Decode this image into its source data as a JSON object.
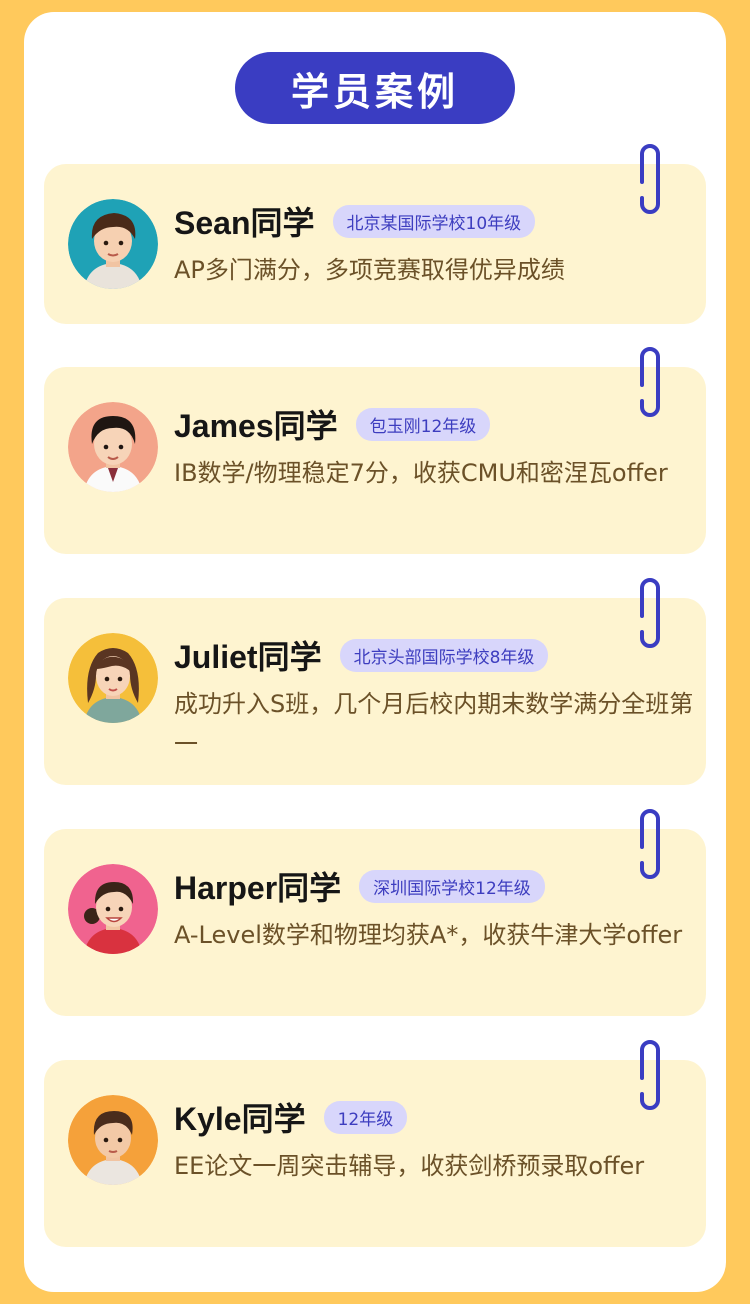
{
  "header": {
    "title": "学员案例"
  },
  "colors": {
    "background": "#ffc95c",
    "pill": "#3a3dc2",
    "card": "#fef4d0",
    "tag_bg": "#d8d6fb",
    "tag_text": "#3d3dbf",
    "desc_text": "#6b5128",
    "clip": "#3a3dc2"
  },
  "cases": [
    {
      "name": "Sean同学",
      "tag": "北京某国际学校10年级",
      "desc": "AP多门满分，多项竞赛取得优异成绩",
      "avatar": "boy-avatar-teal"
    },
    {
      "name": "James同学",
      "tag": "包玉刚12年级",
      "desc": "IB数学/物理稳定7分，收获CMU和密涅瓦offer",
      "avatar": "boy-avatar-salmon"
    },
    {
      "name": "Juliet同学",
      "tag": "北京头部国际学校8年级",
      "desc": "成功升入S班，几个月后校内期末数学满分全班第一",
      "avatar": "girl-avatar-yellow"
    },
    {
      "name": "Harper同学",
      "tag": "深圳国际学校12年级",
      "desc": "A-Level数学和物理均获A*，收获牛津大学offer",
      "avatar": "girl-avatar-pink"
    },
    {
      "name": "Kyle同学",
      "tag": "12年级",
      "desc": "EE论文一周突击辅导，收获剑桥预录取offer",
      "avatar": "boy-avatar-orange"
    }
  ]
}
